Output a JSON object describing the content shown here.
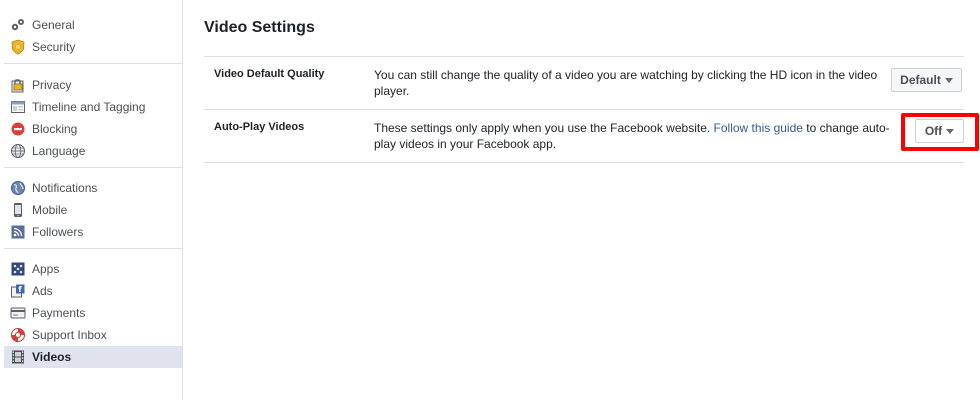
{
  "sidebar": {
    "groups": [
      {
        "items": [
          {
            "label": "General",
            "icon": "gears-icon"
          },
          {
            "label": "Security",
            "icon": "shield-icon"
          }
        ]
      },
      {
        "items": [
          {
            "label": "Privacy",
            "icon": "lock-icon"
          },
          {
            "label": "Timeline and Tagging",
            "icon": "timeline-icon"
          },
          {
            "label": "Blocking",
            "icon": "blocking-icon"
          },
          {
            "label": "Language",
            "icon": "globe-icon"
          }
        ]
      },
      {
        "items": [
          {
            "label": "Notifications",
            "icon": "notifications-globe-icon"
          },
          {
            "label": "Mobile",
            "icon": "mobile-icon"
          },
          {
            "label": "Followers",
            "icon": "rss-icon"
          }
        ]
      },
      {
        "items": [
          {
            "label": "Apps",
            "icon": "apps-icon"
          },
          {
            "label": "Ads",
            "icon": "ads-icon"
          },
          {
            "label": "Payments",
            "icon": "credit-card-icon"
          },
          {
            "label": "Support Inbox",
            "icon": "lifebuoy-icon"
          },
          {
            "label": "Videos",
            "icon": "film-icon",
            "active": true
          }
        ]
      }
    ]
  },
  "main": {
    "title": "Video Settings",
    "settings": [
      {
        "name": "Video Default Quality",
        "description": "You can still change the quality of a video you are watching by clicking the HD icon in the video player.",
        "control_value": "Default"
      },
      {
        "name": "Auto-Play Videos",
        "description_before": "These settings only apply when you use the Facebook website. ",
        "link_text": "Follow this guide",
        "description_after": " to change auto-play videos in your Facebook app.",
        "control_value": "Off",
        "highlight_color": "#ff0000"
      }
    ]
  }
}
